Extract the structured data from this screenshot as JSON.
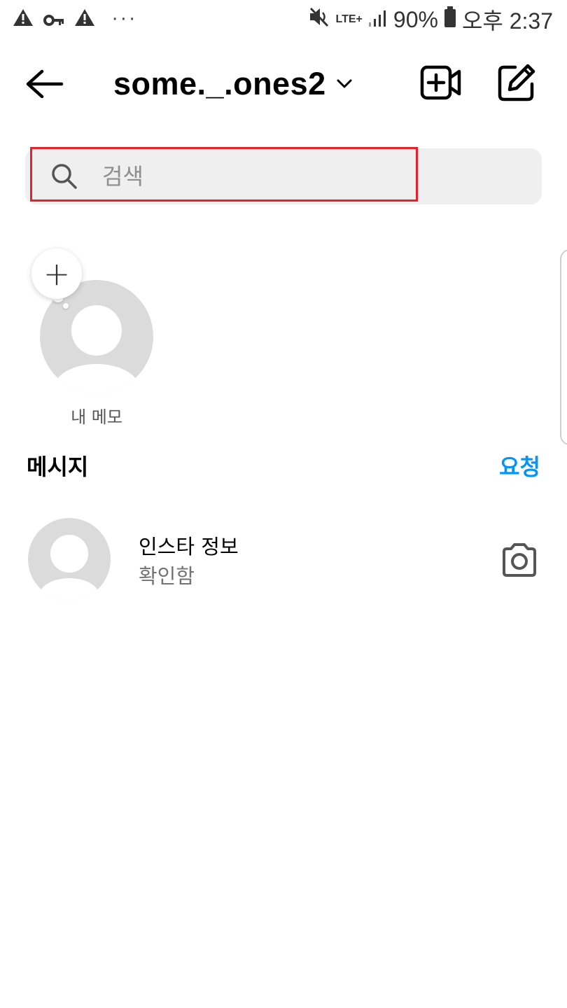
{
  "status_bar": {
    "left_icons": [
      "warning-icon",
      "key-icon",
      "warning-icon"
    ],
    "more": "···",
    "network": "LTE+",
    "battery": "90%",
    "time": "오후 2:37"
  },
  "header": {
    "account_name": "some._.ones2"
  },
  "search": {
    "placeholder": "검색",
    "value": ""
  },
  "note": {
    "add_symbol": "+",
    "label": "내 메모"
  },
  "messages": {
    "section_title": "메시지",
    "requests_label": "요청",
    "threads": [
      {
        "name": "인스타 정보",
        "status": "확인함"
      }
    ]
  },
  "colors": {
    "accent": "#0095f6",
    "search_bg": "#efefef",
    "avatar_placeholder": "#dbdbdb",
    "highlight": "#e0232c"
  }
}
